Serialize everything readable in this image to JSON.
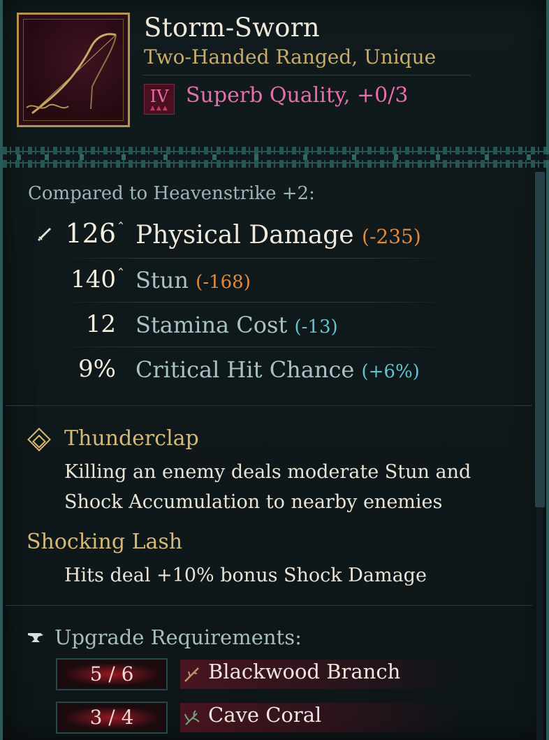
{
  "item": {
    "name": "Storm-Sworn",
    "type": "Two-Handed Ranged, Unique",
    "quality_tier": "IV",
    "quality": "Superb Quality, +0/3",
    "icon": "bow-icon"
  },
  "comparison": {
    "label": "Compared to Heavenstrike +2:"
  },
  "stats": [
    {
      "value": "126",
      "caret": "ˆ",
      "name": "Physical Damage",
      "diff": "(-235)",
      "diff_color": "#e08a3c",
      "name_color": "#efe9dc",
      "icon": "sword-icon"
    },
    {
      "value": "140",
      "caret": "ˆ",
      "name": "Stun",
      "diff": "(-168)",
      "diff_color": "#e08a3c",
      "name_color": "#a9c3c4"
    },
    {
      "value": "12",
      "caret": "",
      "name": "Stamina Cost",
      "diff": "(-13)",
      "diff_color": "#5fc6cf",
      "name_color": "#a9c3c4"
    },
    {
      "value": "9%",
      "caret": "",
      "name": "Critical Hit Chance",
      "diff": "(+6%)",
      "diff_color": "#5fc6cf",
      "name_color": "#a9c3c4"
    }
  ],
  "perks": [
    {
      "title": "Thunderclap",
      "desc": [
        "Killing an enemy deals moderate Stun and",
        "Shock Accumulation to nearby enemies"
      ],
      "icon": "diamond-icon"
    },
    {
      "title": "Shocking Lash",
      "desc": [
        "Hits deal +10% bonus Shock Damage"
      ]
    }
  ],
  "upgrade": {
    "title": "Upgrade Requirements:",
    "icon": "anvil-icon",
    "requirements": [
      {
        "count": "5 / 6",
        "name": "Blackwood Branch",
        "icon": "branch-icon"
      },
      {
        "count": "3 / 4",
        "name": "Cave Coral",
        "icon": "coral-icon"
      }
    ]
  }
}
